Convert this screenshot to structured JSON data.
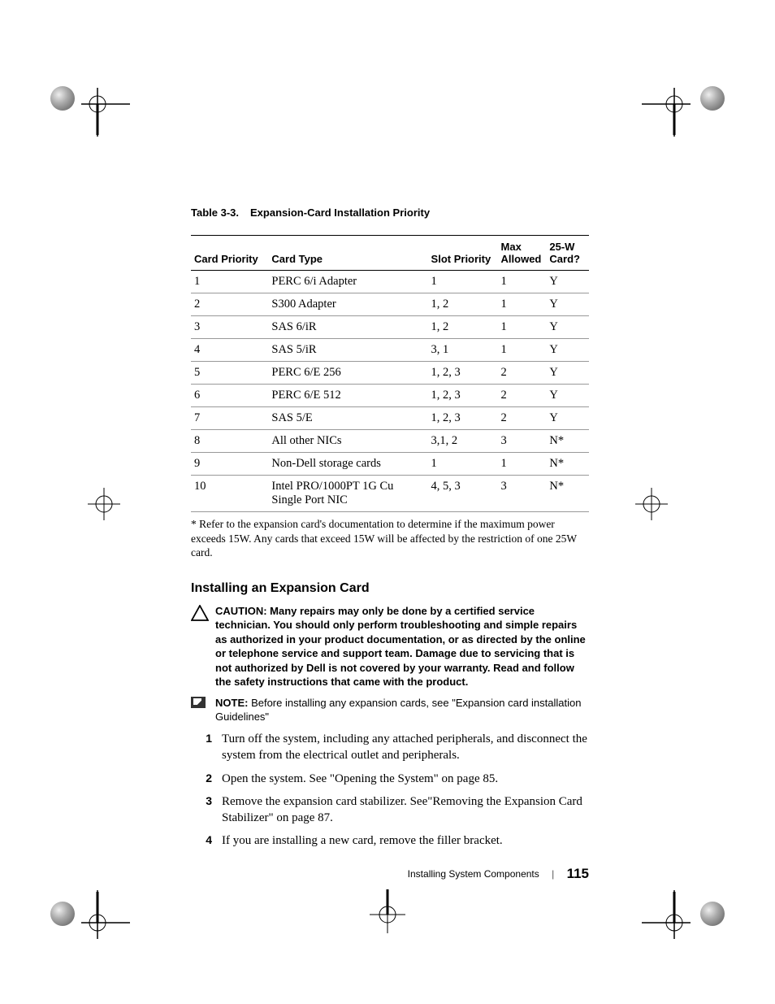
{
  "table": {
    "caption_num": "Table 3-3.",
    "caption_title": "Expansion-Card Installation Priority",
    "headers": {
      "card_priority": "Card Priority",
      "card_type": "Card Type",
      "slot_priority": "Slot Priority",
      "max_allowed": "Max Allowed",
      "w25": "25-W Card?"
    },
    "rows": [
      {
        "priority": "1",
        "type": "PERC 6/i Adapter",
        "slot": "1",
        "max": "1",
        "w25": "Y"
      },
      {
        "priority": "2",
        "type": "S300 Adapter",
        "slot": "1, 2",
        "max": "1",
        "w25": "Y"
      },
      {
        "priority": "3",
        "type": "SAS 6/iR",
        "slot": "1, 2",
        "max": "1",
        "w25": "Y"
      },
      {
        "priority": "4",
        "type": "SAS 5/iR",
        "slot": "3, 1",
        "max": "1",
        "w25": "Y"
      },
      {
        "priority": "5",
        "type": "PERC 6/E 256",
        "slot": "1, 2, 3",
        "max": "2",
        "w25": "Y"
      },
      {
        "priority": "6",
        "type": "PERC 6/E 512",
        "slot": "1, 2, 3",
        "max": "2",
        "w25": "Y"
      },
      {
        "priority": "7",
        "type": "SAS 5/E",
        "slot": "1, 2, 3",
        "max": "2",
        "w25": "Y"
      },
      {
        "priority": "8",
        "type": "All other NICs",
        "slot": "3,1, 2",
        "max": "3",
        "w25": "N*"
      },
      {
        "priority": "9",
        "type": "Non-Dell storage cards",
        "slot": "1",
        "max": "1",
        "w25": "N*"
      },
      {
        "priority": "10",
        "type": "Intel PRO/1000PT 1G Cu Single Port NIC",
        "slot": "4, 5, 3",
        "max": "3",
        "w25": "N*"
      }
    ],
    "footnote": "* Refer to the expansion card's documentation to determine if the maximum power exceeds 15W. Any cards that exceed 15W will be affected by the restriction of one 25W card."
  },
  "section": {
    "heading": "Installing an Expansion Card",
    "caution_label": "CAUTION: ",
    "caution_text": "Many repairs may only be done by a certified service technician. You should only perform troubleshooting and simple repairs as authorized in your product documentation, or as directed by the online or telephone service and support team. Damage due to servicing that is not authorized by Dell is not covered by your warranty. Read and follow the safety instructions that came with the product.",
    "note_label": "NOTE: ",
    "note_text": "Before installing any expansion cards, see \"Expansion card installation Guidelines\"",
    "steps": [
      "Turn off the system, including any attached peripherals, and disconnect the system from the electrical outlet and peripherals.",
      "Open the system. See \"Opening the System\" on page 85.",
      "Remove the expansion card stabilizer. See\"Removing the Expansion Card Stabilizer\" on page 87.",
      "If you are installing a new card, remove the filler bracket."
    ]
  },
  "footer": {
    "chapter": "Installing System Components",
    "page": "115"
  },
  "chart_data": {
    "type": "table",
    "title": "Expansion-Card Installation Priority",
    "columns": [
      "Card Priority",
      "Card Type",
      "Slot Priority",
      "Max Allowed",
      "25-W Card?"
    ],
    "rows": [
      [
        "1",
        "PERC 6/i Adapter",
        "1",
        "1",
        "Y"
      ],
      [
        "2",
        "S300 Adapter",
        "1, 2",
        "1",
        "Y"
      ],
      [
        "3",
        "SAS 6/iR",
        "1, 2",
        "1",
        "Y"
      ],
      [
        "4",
        "SAS 5/iR",
        "3, 1",
        "1",
        "Y"
      ],
      [
        "5",
        "PERC 6/E 256",
        "1, 2, 3",
        "2",
        "Y"
      ],
      [
        "6",
        "PERC 6/E 512",
        "1, 2, 3",
        "2",
        "Y"
      ],
      [
        "7",
        "SAS 5/E",
        "1, 2, 3",
        "2",
        "Y"
      ],
      [
        "8",
        "All other NICs",
        "3,1, 2",
        "3",
        "N*"
      ],
      [
        "9",
        "Non-Dell storage cards",
        "1",
        "1",
        "N*"
      ],
      [
        "10",
        "Intel PRO/1000PT 1G Cu Single Port NIC",
        "4, 5, 3",
        "3",
        "N*"
      ]
    ]
  }
}
